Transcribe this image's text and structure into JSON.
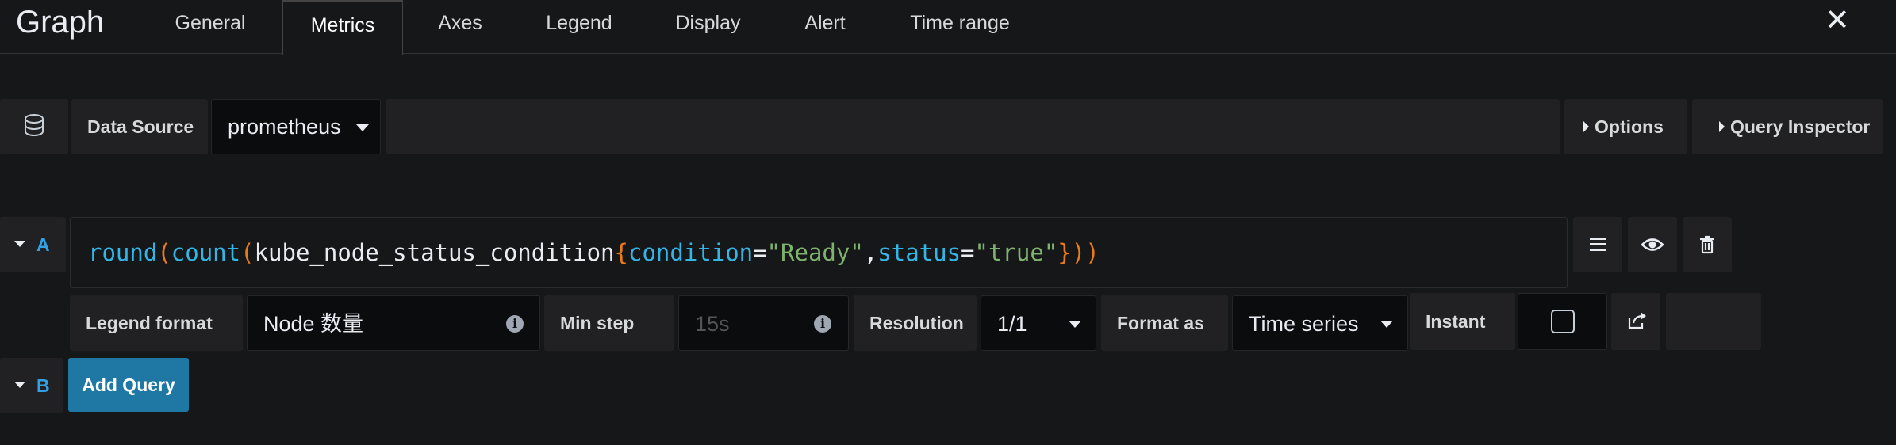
{
  "header": {
    "title": "Graph",
    "tabs": [
      {
        "label": "General"
      },
      {
        "label": "Metrics"
      },
      {
        "label": "Axes"
      },
      {
        "label": "Legend"
      },
      {
        "label": "Display"
      },
      {
        "label": "Alert"
      },
      {
        "label": "Time range"
      }
    ],
    "active_tab": "Metrics"
  },
  "datasource": {
    "label": "Data Source",
    "value": "prometheus",
    "options_label": "Options",
    "query_inspector_label": "Query Inspector"
  },
  "query_a": {
    "ref": "A",
    "expr": {
      "fn1": "round",
      "p1": "(",
      "fn2": "count",
      "p2": "(",
      "metric": "kube_node_status_condition",
      "lbrace": "{",
      "key1": "condition",
      "eq1": "=",
      "val1": "\"Ready\"",
      "comma": ",",
      "key2": "status",
      "eq2": "=",
      "val2": "\"true\"",
      "rbrace": "}",
      "p3": ")",
      "p4": ")"
    },
    "legend_format_label": "Legend format",
    "legend_format_value": "Node 数量",
    "min_step_label": "Min step",
    "min_step_placeholder": "15s",
    "resolution_label": "Resolution",
    "resolution_value": "1/1",
    "format_as_label": "Format as",
    "format_as_value": "Time series",
    "instant_label": "Instant",
    "instant_checked": false
  },
  "query_b": {
    "ref": "B",
    "add_query_label": "Add Query"
  }
}
